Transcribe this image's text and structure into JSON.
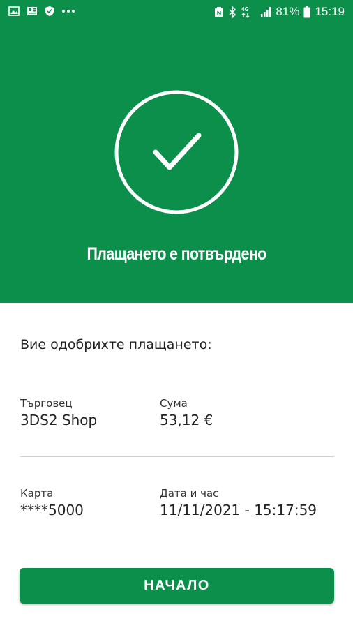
{
  "status_bar": {
    "left_icons": [
      "image-icon",
      "news-icon",
      "shield-icon",
      "more-dots-icon"
    ],
    "right_icons": [
      "nfc-icon",
      "bluetooth-icon",
      "4g-icon",
      "signal-icon",
      "battery-icon"
    ],
    "network": "4G",
    "battery": "81%",
    "time": "15:19"
  },
  "hero": {
    "title": "Плащането е потвърдено",
    "icon": "check-circle-icon",
    "background_color": "#0b8f4a"
  },
  "details": {
    "intro": "Вие одобрихте плащането:",
    "merchant_label": "Търговец",
    "merchant_value": "3DS2 Shop",
    "amount_label": "Сума",
    "amount_value": "53,12 €",
    "card_label": "Карта",
    "card_value": "****5000",
    "datetime_label": "Дата и час",
    "datetime_value": "11/11/2021 - 15:17:59"
  },
  "actions": {
    "home_label": "НАЧАЛО"
  }
}
